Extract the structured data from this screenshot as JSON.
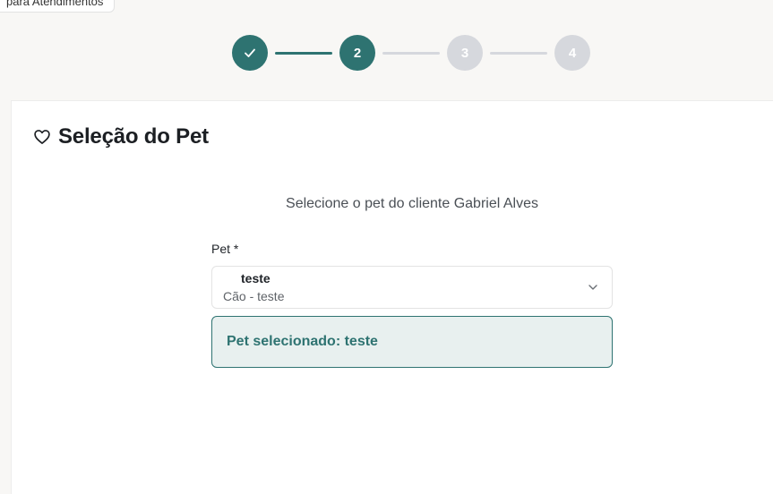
{
  "top_link": {
    "label": "para Atendimentos"
  },
  "stepper": {
    "steps": [
      {
        "label": "✓",
        "state": "done"
      },
      {
        "label": "2",
        "state": "current"
      },
      {
        "label": "3",
        "state": "pending"
      },
      {
        "label": "4",
        "state": "pending"
      }
    ]
  },
  "card": {
    "icon": "heart-icon",
    "title": "Seleção do Pet",
    "subtitle": "Selecione o pet do cliente Gabriel Alves",
    "pet_field": {
      "label": "Pet *",
      "selected_name": "teste",
      "selected_desc": "Cão - teste"
    },
    "selected_message": "Pet selecionado: teste"
  },
  "colors": {
    "accent": "#2e7371",
    "inactive": "#d6d8dd",
    "selected_bg": "#e8f0ef"
  }
}
